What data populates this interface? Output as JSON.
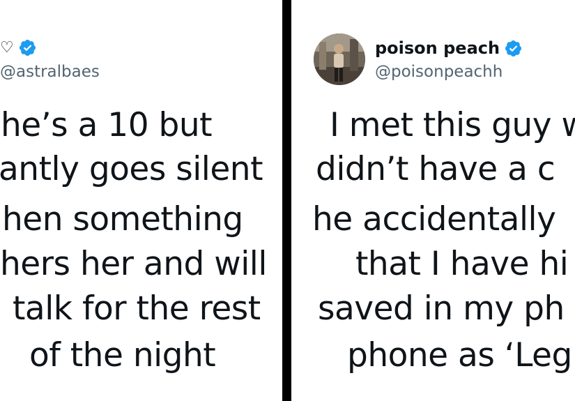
{
  "left_tweet": {
    "name_partial": "",
    "name_suffix_icon": "heart-outline-icon",
    "verified_icon": "verified-badge-icon",
    "handle": "@astralbaes",
    "lines": [
      "he’s a 10 but",
      "antly goes silent",
      "hen something",
      "hers her and will",
      "talk for the rest",
      "of the night"
    ]
  },
  "right_tweet": {
    "avatar_icon": "profile-avatar",
    "display_name": "poison peach",
    "verified_icon": "verified-badge-icon",
    "handle": "@poisonpeachh",
    "lines": [
      "I met this guy w",
      "didn’t have a c",
      "he accidentally",
      "that I have hi",
      "saved in my ph",
      "phone as ‘Leg"
    ]
  },
  "colors": {
    "background_divider": "#000000",
    "card_background": "#ffffff",
    "text_primary": "#0f1419",
    "text_secondary": "#536471",
    "verified_blue": "#1d9bf0"
  }
}
